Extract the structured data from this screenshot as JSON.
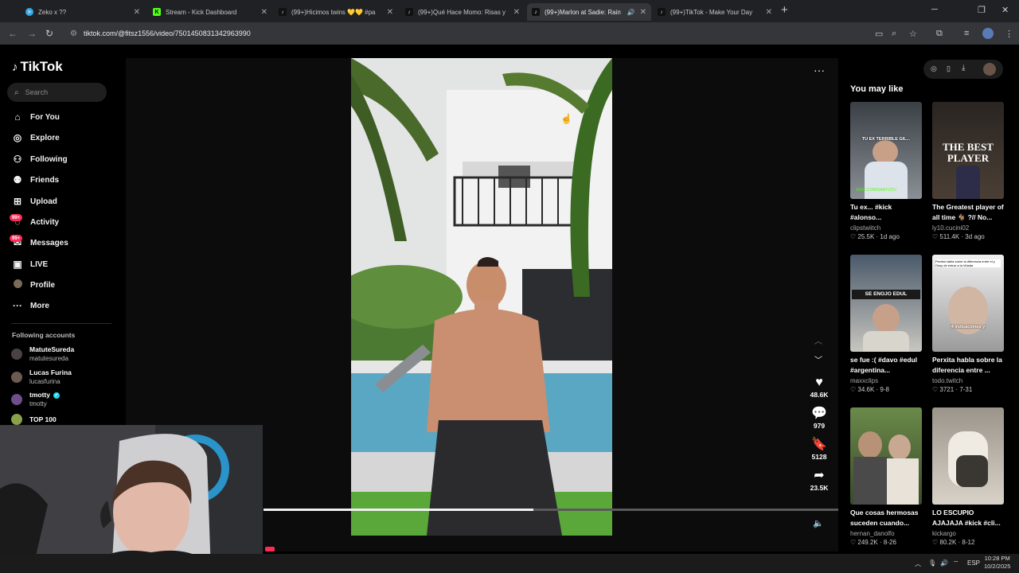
{
  "browser": {
    "tabs": [
      {
        "title": "Zeko x ??",
        "favicon": "telegram-icon",
        "color": "#2aabee"
      },
      {
        "title": "Stream - Kick Dashboard",
        "favicon": "kick-icon",
        "color": "#53fc18"
      },
      {
        "title": "(99+)Hicimos twins 💛💛 #pa",
        "favicon": "tiktok-icon",
        "color": "#000000"
      },
      {
        "title": "(99+)Qué Hace Momo: Risas y",
        "favicon": "tiktok-icon",
        "color": "#000000"
      },
      {
        "title": "(99+)Marlon at Sadie: Rain",
        "favicon": "tiktok-icon",
        "color": "#000000"
      },
      {
        "title": "(99+)TikTok - Make Your Day",
        "favicon": "tiktok-icon",
        "color": "#000000"
      }
    ],
    "url": "tiktok.com/@fitsz1556/video/7501450831342963990"
  },
  "sidebar": {
    "logo": "TikTok",
    "search_placeholder": "Search",
    "items": [
      {
        "label": "For You",
        "icon": "home-icon"
      },
      {
        "label": "Explore",
        "icon": "compass-icon"
      },
      {
        "label": "Following",
        "icon": "following-icon"
      },
      {
        "label": "Friends",
        "icon": "friends-icon"
      },
      {
        "label": "Upload",
        "icon": "upload-icon"
      },
      {
        "label": "Activity",
        "icon": "activity-icon",
        "badge": "99+"
      },
      {
        "label": "Messages",
        "icon": "messages-icon",
        "badge": "99+"
      },
      {
        "label": "LIVE",
        "icon": "live-icon"
      },
      {
        "label": "Profile",
        "icon": "profile-icon"
      },
      {
        "label": "More",
        "icon": "more-icon"
      }
    ],
    "following_title": "Following accounts",
    "accounts": [
      {
        "name": "MatuteSureda",
        "user": "matutesureda",
        "verified": false
      },
      {
        "name": "Lucas Furina",
        "user": "lucasfurina",
        "verified": false
      },
      {
        "name": "tmotty",
        "user": "tmotty",
        "verified": true
      },
      {
        "name": "TOP 100",
        "user": "",
        "verified": false
      }
    ]
  },
  "video": {
    "likes": "48.6K",
    "comments": "979",
    "saves": "5128",
    "shares": "23.5K",
    "progress": 0.47
  },
  "recommendations": {
    "title": "You may like",
    "cards": [
      {
        "caption": "Tu ex... #kick #alonso...",
        "author": "clipstwiitch",
        "likes": "25.5K",
        "age": "1d ago",
        "thumb_text": "TU EX TERRIBLE GIL...",
        "thumb_sub": "KICK.COM/SANTUTU"
      },
      {
        "caption": "The Greatest player of all time 🐐 ?// No...",
        "author": "ly10.cucini02",
        "likes": "511.4K",
        "age": "3d ago",
        "thumb_text": "THE BEST PLAYER",
        "thumb_sub": ""
      },
      {
        "caption": "se fue :( #davo #edul #argentina...",
        "author": "maxxclips",
        "likes": "34.6K",
        "age": "9-8",
        "thumb_text": "SE ENOJO EDUL",
        "thumb_sub": ""
      },
      {
        "caption": "Perxita habla sobre la diferencia entre ...",
        "author": "todo.twitch",
        "likes": "3721",
        "age": "7-31",
        "thumb_text": "Perxita habla sobre la diferencia entre el y Ossy de entrar a la Velada",
        "thumb_sub": "4 indicaciones y"
      },
      {
        "caption": "Que cosas hermosas suceden cuando...",
        "author": "hernan_danolfo",
        "likes": "249.2K",
        "age": "8-26",
        "thumb_text": "",
        "thumb_sub": ""
      },
      {
        "caption": "LO ESCUPIO AJAJAJA #kick #cli...",
        "author": "kickargo",
        "likes": "80.2K",
        "age": "8-12",
        "thumb_text": "",
        "thumb_sub": ""
      }
    ]
  },
  "taskbar": {
    "lang": "ESP",
    "time": "10:28 PM",
    "date": "10/2/2025"
  }
}
